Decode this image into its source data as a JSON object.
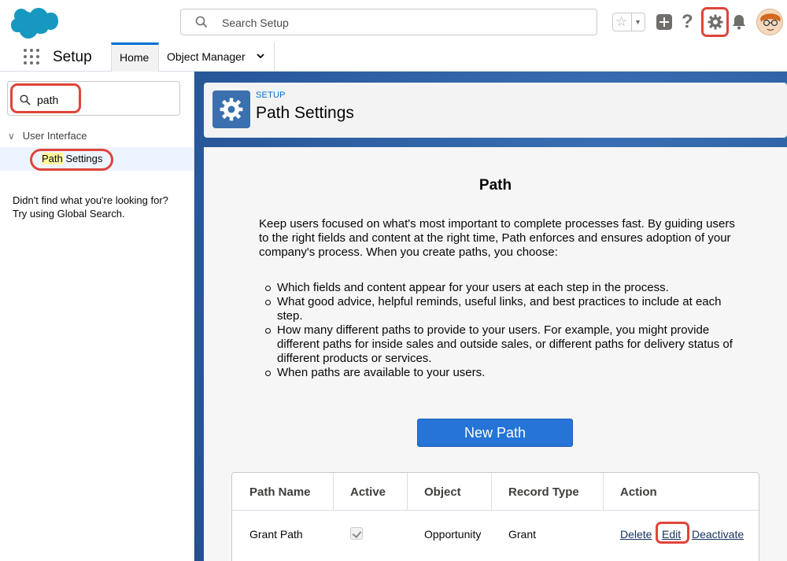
{
  "header": {
    "search_placeholder": "Search Setup",
    "help_label": "?"
  },
  "nav": {
    "app_name": "Setup",
    "tabs": [
      {
        "label": "Home",
        "active": true
      },
      {
        "label": "Object Manager",
        "active": false
      }
    ]
  },
  "sidebar": {
    "search_value": "path",
    "group_label": "User Interface",
    "item_highlight": "Path",
    "item_rest": " Settings",
    "note_line1": "Didn't find what you're looking for?",
    "note_line2": "Try using Global Search."
  },
  "page_header": {
    "eyebrow": "SETUP",
    "title": "Path Settings"
  },
  "content": {
    "title": "Path",
    "intro": "Keep users focused on what's most important to complete processes fast. By guiding users to the right fields and content at the right time, Path enforces and ensures adoption of your company's process. When you create paths, you choose:",
    "bullets": [
      "Which fields and content appear for your users at each step in the process.",
      "What good advice, helpful reminds, useful links, and best practices to include at each step.",
      "How many different paths to provide to your users. For example, you might provide different paths for inside sales and outside sales, or different paths for delivery status of different products or services.",
      "When paths are available to your users."
    ],
    "new_path_label": "New Path"
  },
  "table": {
    "headers": [
      "Path Name",
      "Active",
      "Object",
      "Record Type",
      "Action"
    ],
    "row": {
      "path_name": "Grant Path",
      "active": true,
      "object": "Opportunity",
      "record_type": "Grant",
      "actions": [
        "Delete",
        "Edit",
        "Deactivate"
      ]
    }
  },
  "colors": {
    "brand_blue": "#0070d2",
    "button_blue": "#2574d6",
    "highlight_red": "#e0443a"
  }
}
